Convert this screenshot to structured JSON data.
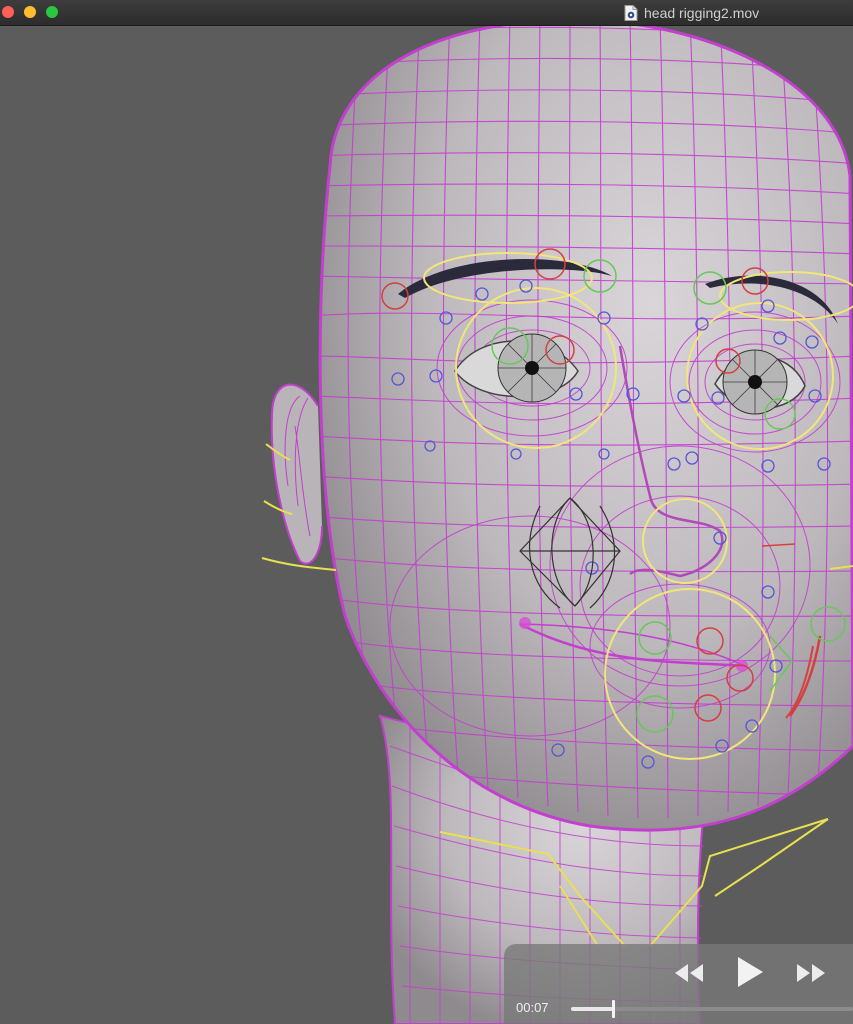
{
  "window": {
    "title": "head rigging2.mov",
    "buttons": [
      "close",
      "minimize",
      "zoom"
    ],
    "document_icon": "movie-document-icon"
  },
  "viewport": {
    "content": "3d-head-rig-wireframe",
    "colors": {
      "background": "#5c5c5c",
      "mesh_surface": "#c9c4c7",
      "wireframe": "#c23fcf",
      "eye_controls": "#f0e67a",
      "red_controls": "#d44040",
      "green_controls": "#66c85a",
      "blue_joints": "#5656d6",
      "neck_controls": "#e8e050",
      "brows": "#2a2a3a"
    }
  },
  "player": {
    "current_time": "00:07",
    "progress": 0.15,
    "rewind_icon": "rewind-icon",
    "play_icon": "play-icon",
    "fast_forward_icon": "fast-forward-icon"
  }
}
